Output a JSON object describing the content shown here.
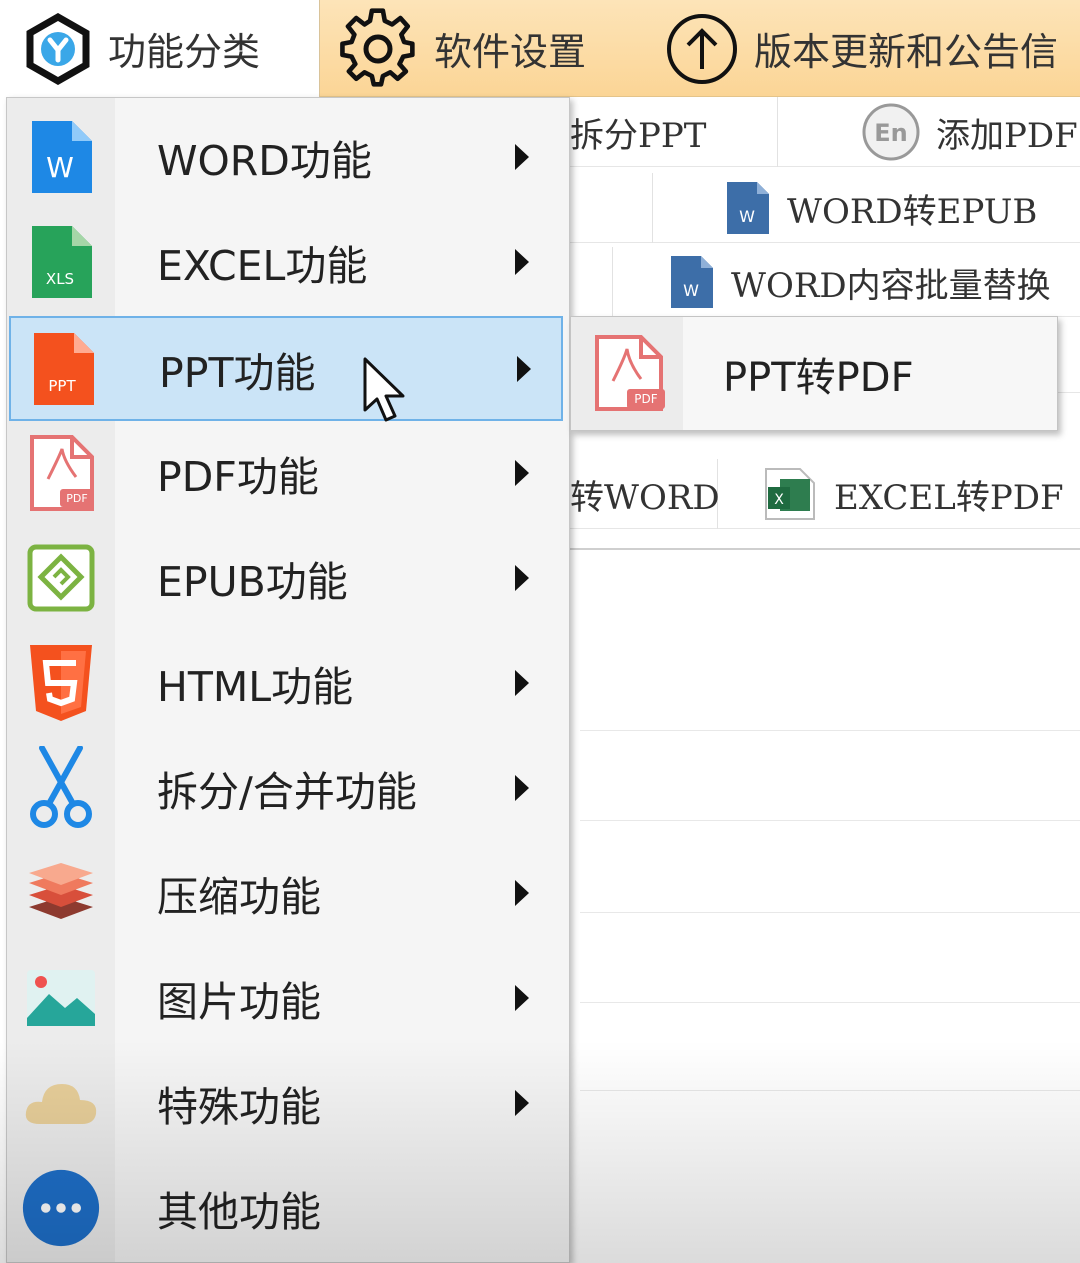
{
  "top_tabs": {
    "category_label": "功能分类",
    "settings_label": "软件设置",
    "update_label": "版本更新和公告信"
  },
  "toolbar_bg": {
    "row1": [
      "拆分PPT",
      "添加PDF"
    ],
    "row2": [
      "WORD转EPUB"
    ],
    "row3": [
      "WORD内容批量替换"
    ],
    "row5": [
      "转WORD",
      "EXCEL转PDF"
    ]
  },
  "menu": {
    "items": [
      {
        "label": "WORD功能",
        "icon": "word-icon"
      },
      {
        "label": "EXCEL功能",
        "icon": "excel-icon"
      },
      {
        "label": "PPT功能",
        "icon": "ppt-icon",
        "active": true
      },
      {
        "label": "PDF功能",
        "icon": "pdf-icon"
      },
      {
        "label": "EPUB功能",
        "icon": "epub-icon"
      },
      {
        "label": "HTML功能",
        "icon": "html5-icon"
      },
      {
        "label": "拆分/合并功能",
        "icon": "scissors-icon"
      },
      {
        "label": "压缩功能",
        "icon": "layers-icon"
      },
      {
        "label": "图片功能",
        "icon": "image-icon"
      },
      {
        "label": "特殊功能",
        "icon": "cloud-icon"
      },
      {
        "label": "其他功能",
        "icon": "more-icon"
      }
    ]
  },
  "submenu": {
    "items": [
      {
        "label": "PPT转PDF",
        "icon": "pdf-file-icon"
      }
    ]
  },
  "colors": {
    "topbar": "#fbd596",
    "menu_bg": "#f5f5f5",
    "active_bg": "#cbe4f7",
    "active_border": "#6fb2e8",
    "word_blue": "#1e88e5",
    "excel_green": "#27a35a",
    "ppt_orange": "#f4511e",
    "pdf_red": "#e57373",
    "epub_green": "#7cb342",
    "html_orange": "#f4511e"
  }
}
